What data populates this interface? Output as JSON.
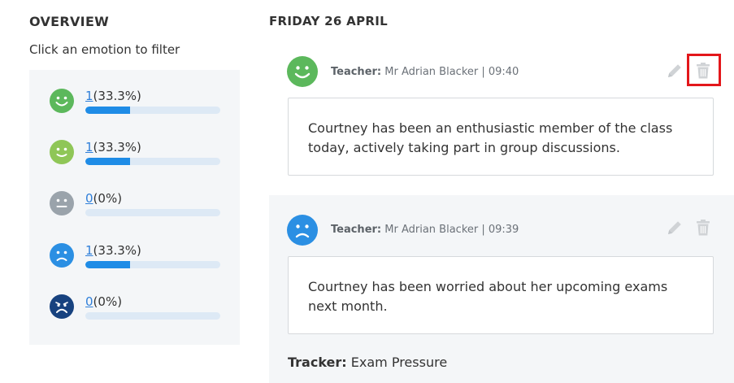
{
  "overview": {
    "title": "OVERVIEW",
    "subtitle": "Click an emotion to filter",
    "emotions": [
      {
        "icon": "very-happy-face-icon",
        "color": "#5cb85c",
        "count": "1",
        "percent": "(33.3%)",
        "fraction": 0.333
      },
      {
        "icon": "happy-face-icon",
        "color": "#8fc657",
        "count": "1",
        "percent": "(33.3%)",
        "fraction": 0.333
      },
      {
        "icon": "neutral-face-icon",
        "color": "#9aa3ab",
        "count": "0",
        "percent": "(0%)",
        "fraction": 0
      },
      {
        "icon": "sad-face-icon",
        "color": "#2b8fe3",
        "count": "1",
        "percent": "(33.3%)",
        "fraction": 0.333
      },
      {
        "icon": "very-sad-face-icon",
        "color": "#17427f",
        "count": "0",
        "percent": "(0%)",
        "fraction": 0
      }
    ]
  },
  "notes": {
    "date_heading": "FRIDAY 26 APRIL",
    "items": [
      {
        "icon": "happy-face-icon",
        "color": "#5cb85c",
        "author_label": "Teacher:",
        "author": "Mr Adrian Blacker | 09:40",
        "text": "Courtney has been an enthusiastic member of the class today, actively taking part in group discussions."
      },
      {
        "icon": "sad-face-icon",
        "color": "#2b8fe3",
        "author_label": "Teacher:",
        "author": "Mr Adrian Blacker | 09:39",
        "text": "Courtney has been worried about her upcoming exams next month.",
        "tracker_label": "Tracker:",
        "tracker_value": "Exam Pressure"
      }
    ]
  },
  "colors": {
    "accent": "#1f8ce6",
    "highlight": "#e3171b",
    "icon_gray": "#d0d3d6"
  }
}
